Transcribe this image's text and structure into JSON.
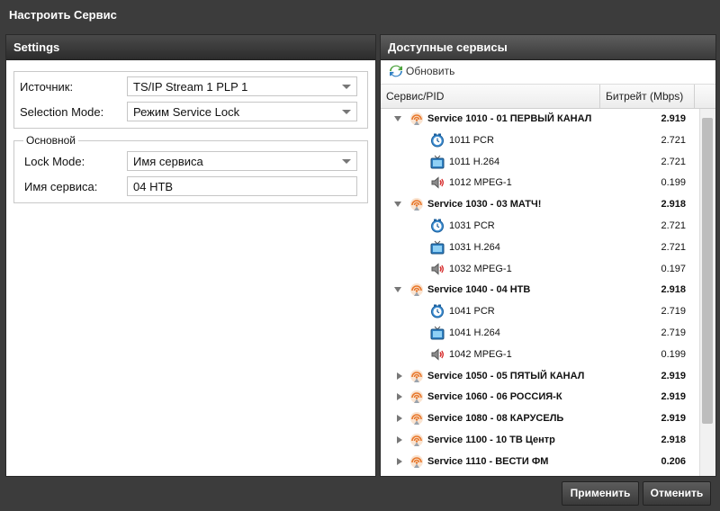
{
  "window": {
    "title": "Настроить Сервис"
  },
  "left": {
    "header": "Settings",
    "source": {
      "label": "Источник:",
      "value": "TS/IP Stream 1 PLP 1"
    },
    "selection_mode": {
      "label": "Selection Mode:",
      "value": "Режим Service Lock"
    },
    "main_section": {
      "legend": "Основной",
      "lock_mode": {
        "label": "Lock Mode:",
        "value": "Имя сервиса"
      },
      "service_name": {
        "label": "Имя сервиса:",
        "value": "04 НТВ"
      }
    }
  },
  "right": {
    "header": "Доступные сервисы",
    "refresh": "Обновить",
    "columns": {
      "service": "Сервис/PID",
      "bitrate": "Битрейт (Mbps)"
    },
    "rows": [
      {
        "type": "service",
        "expanded": true,
        "name": "Service 1010 - 01 ПЕРВЫЙ КАНАЛ",
        "rate": "2.919"
      },
      {
        "type": "pcr",
        "name": "1011 PCR",
        "rate": "2.721"
      },
      {
        "type": "video",
        "name": "1011 H.264",
        "rate": "2.721"
      },
      {
        "type": "audio",
        "name": "1012 MPEG-1",
        "rate": "0.199"
      },
      {
        "type": "service",
        "expanded": true,
        "name": "Service 1030 - 03 МАТЧ!",
        "rate": "2.918"
      },
      {
        "type": "pcr",
        "name": "1031 PCR",
        "rate": "2.721"
      },
      {
        "type": "video",
        "name": "1031 H.264",
        "rate": "2.721"
      },
      {
        "type": "audio",
        "name": "1032 MPEG-1",
        "rate": "0.197"
      },
      {
        "type": "service",
        "expanded": true,
        "name": "Service 1040 - 04 НТВ",
        "rate": "2.918"
      },
      {
        "type": "pcr",
        "name": "1041 PCR",
        "rate": "2.719"
      },
      {
        "type": "video",
        "name": "1041 H.264",
        "rate": "2.719"
      },
      {
        "type": "audio",
        "name": "1042 MPEG-1",
        "rate": "0.199"
      },
      {
        "type": "service",
        "expanded": false,
        "name": "Service 1050 - 05 ПЯТЫЙ КАНАЛ",
        "rate": "2.919"
      },
      {
        "type": "service",
        "expanded": false,
        "name": "Service 1060 - 06 РОССИЯ-К",
        "rate": "2.919"
      },
      {
        "type": "service",
        "expanded": false,
        "name": "Service 1080 - 08 КАРУСЕЛЬ",
        "rate": "2.919"
      },
      {
        "type": "service",
        "expanded": false,
        "name": "Service 1100 - 10 ТВ Центр",
        "rate": "2.918"
      },
      {
        "type": "service",
        "expanded": false,
        "name": "Service 1110 - ВЕСТИ ФМ",
        "rate": "0.206"
      }
    ]
  },
  "footer": {
    "apply": "Применить",
    "cancel": "Отменить"
  }
}
